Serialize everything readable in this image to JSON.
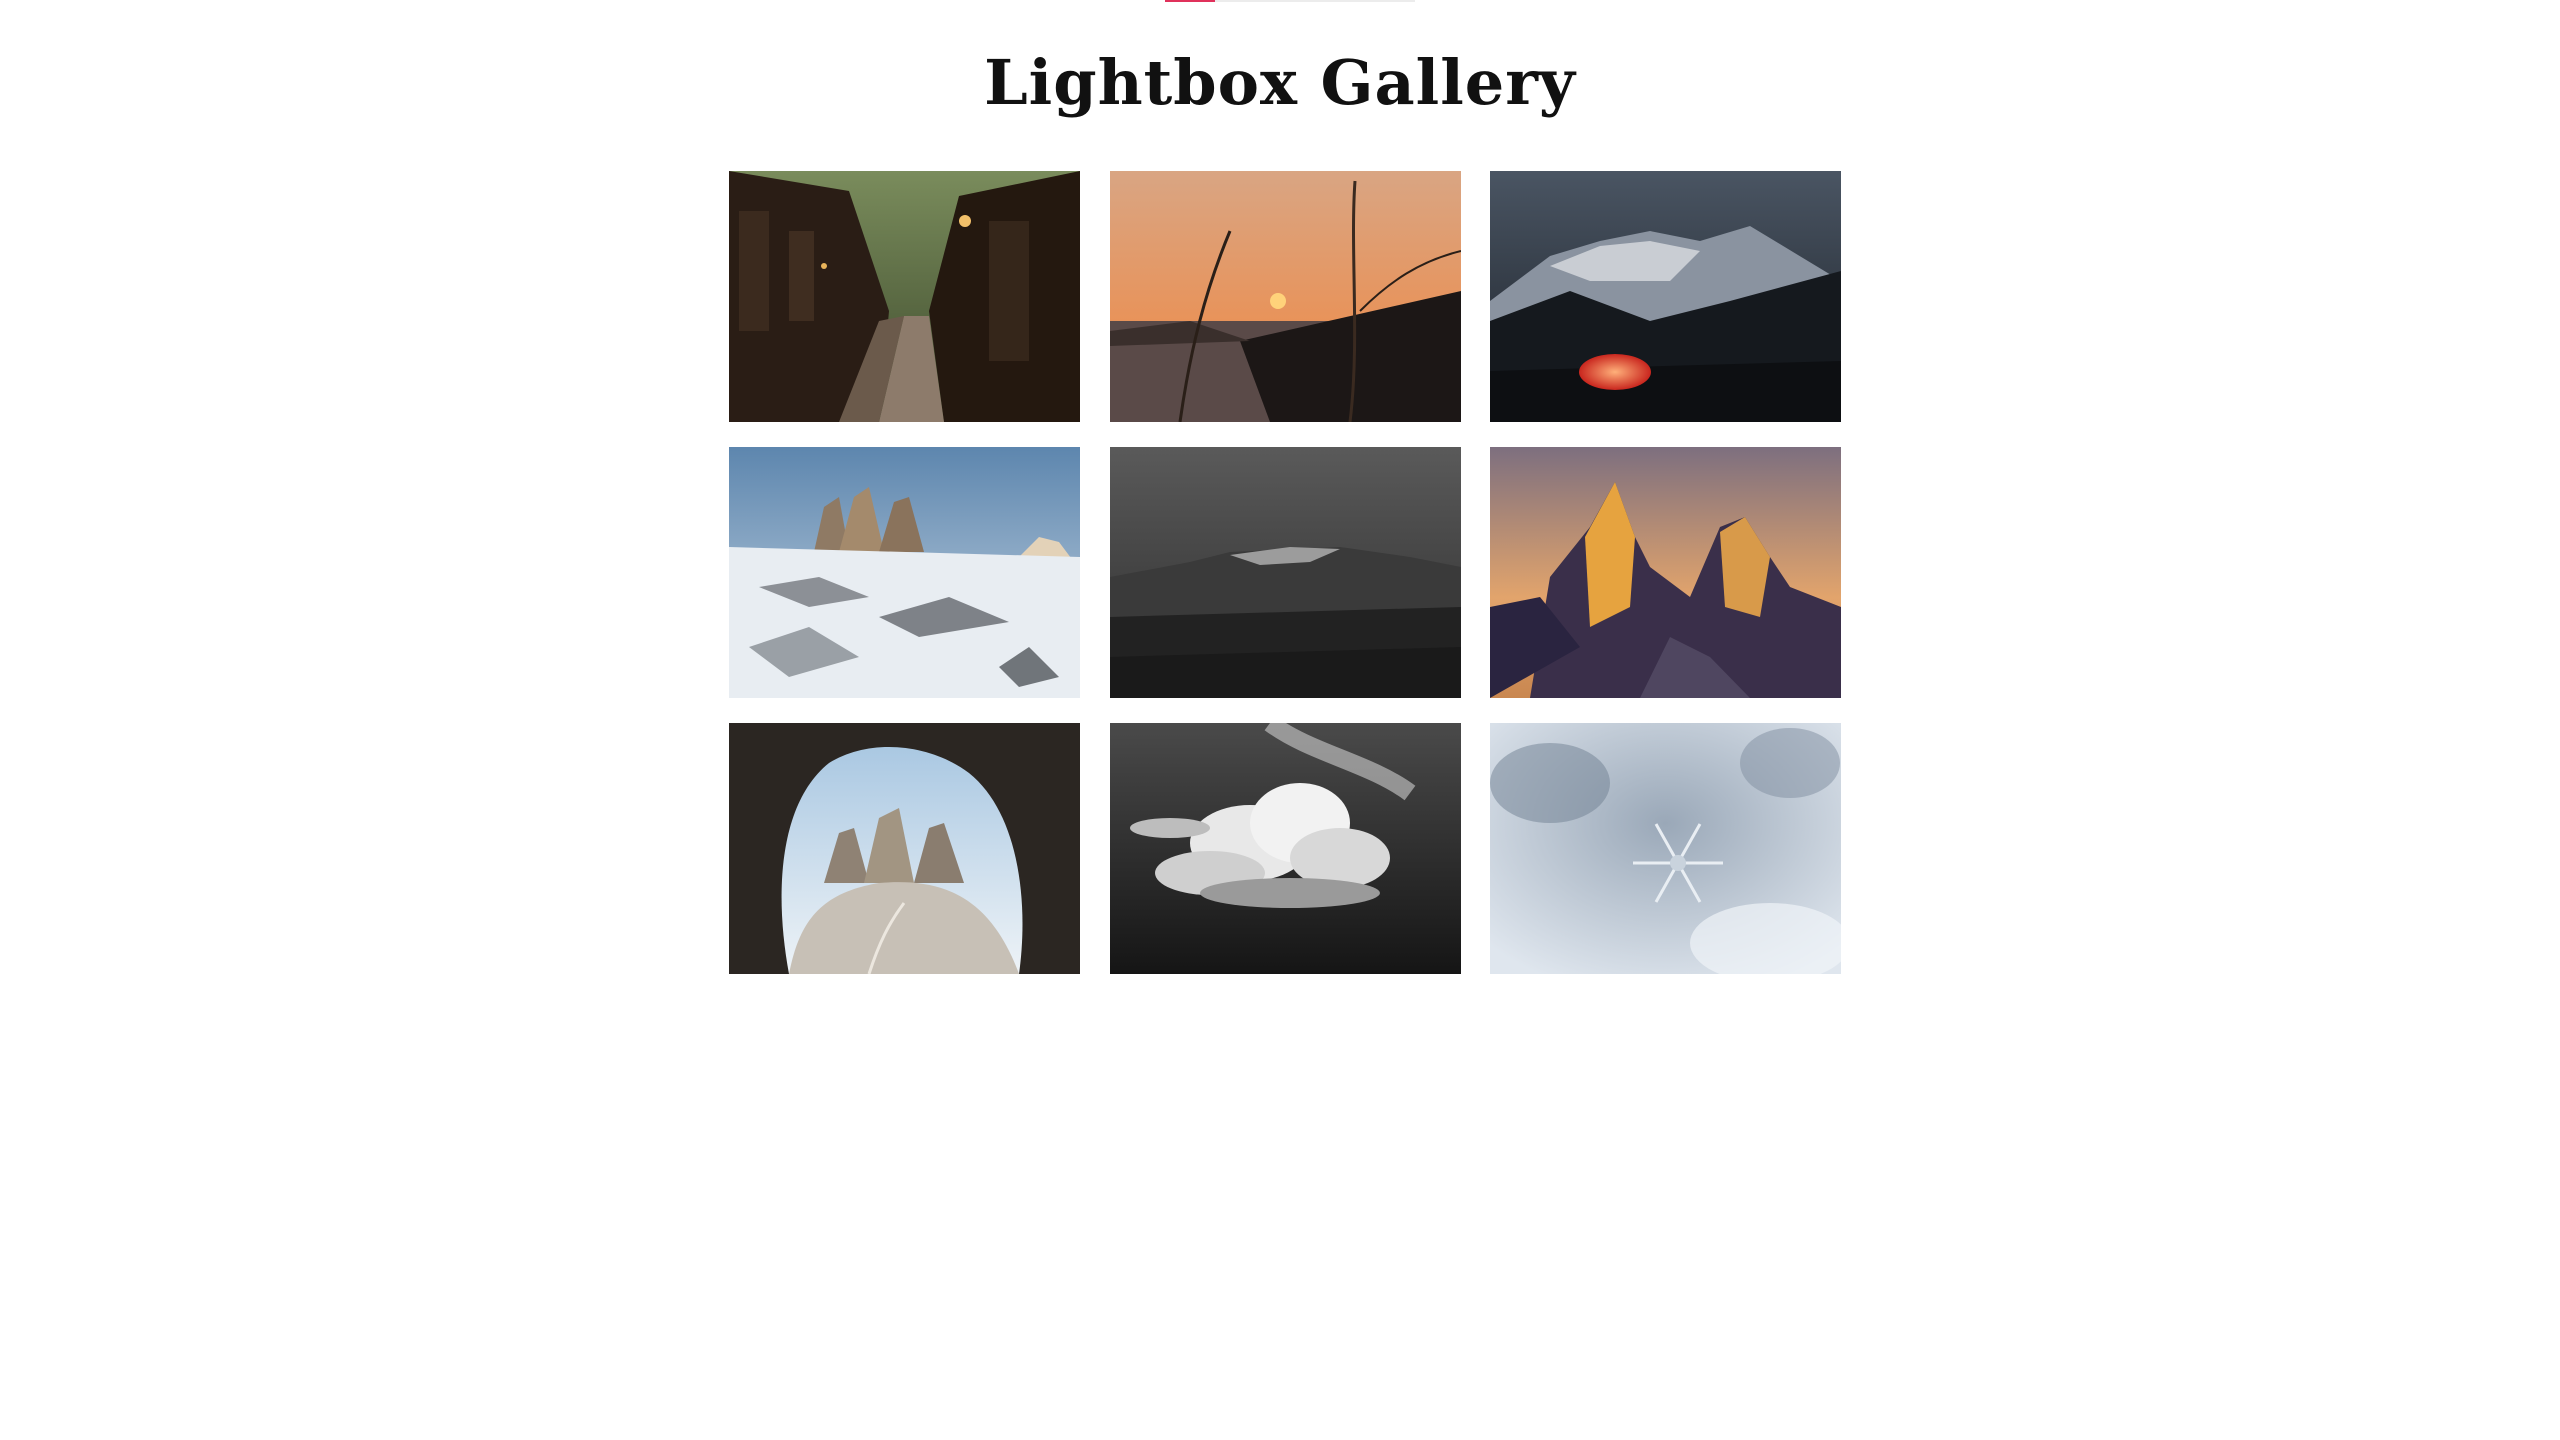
{
  "page": {
    "title": "Lightbox Gallery"
  },
  "colors": {
    "title": "#111111",
    "indicator_track": "#ececec",
    "indicator_active": "#e0315b"
  },
  "gallery": {
    "images": [
      {
        "subject": "japanese-village-street"
      },
      {
        "subject": "sunset-over-lake"
      },
      {
        "subject": "red-tent-mountains-night"
      },
      {
        "subject": "snowy-dolomite-peaks"
      },
      {
        "subject": "black-white-mesa"
      },
      {
        "subject": "golden-mountain-spires"
      },
      {
        "subject": "cave-view-three-peaks"
      },
      {
        "subject": "black-white-cloud"
      },
      {
        "subject": "snowflake-closeup"
      }
    ]
  }
}
